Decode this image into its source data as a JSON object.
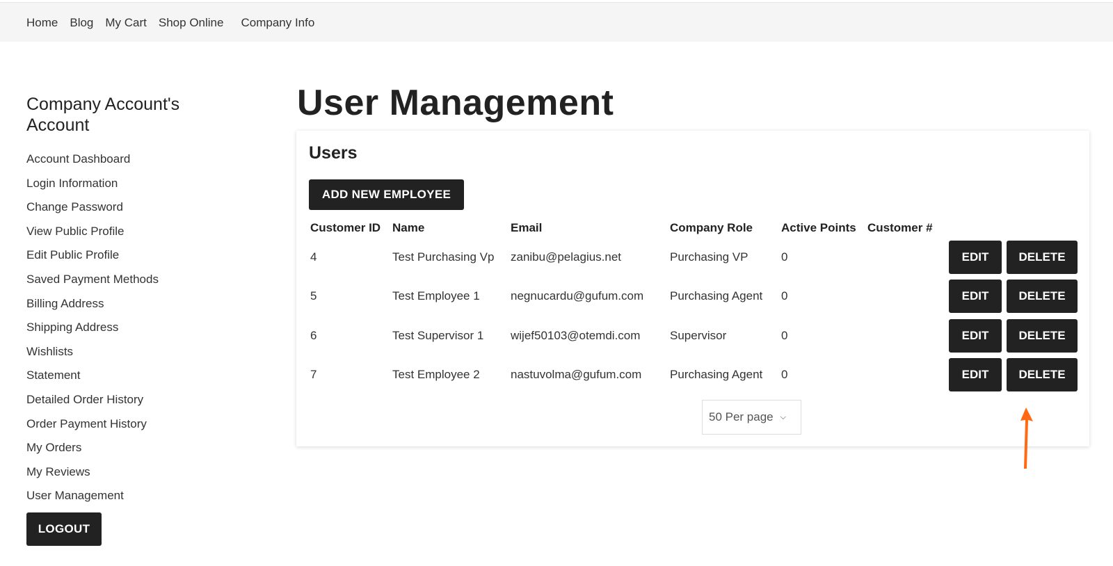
{
  "topnav": {
    "items": [
      "Home",
      "Blog",
      "My Cart",
      "Shop Online",
      "Company Info"
    ]
  },
  "sidebar": {
    "title": "Company Account's Account",
    "items": [
      "Account Dashboard",
      "Login Information",
      "Change Password",
      "View Public Profile",
      "Edit Public Profile",
      "Saved Payment Methods",
      "Billing Address",
      "Shipping Address",
      "Wishlists",
      "Statement",
      "Detailed Order History",
      "Order Payment History",
      "My Orders",
      "My Reviews",
      "User Management"
    ],
    "logout_label": "LOGOUT"
  },
  "page": {
    "title": "User Management"
  },
  "users": {
    "title": "Users",
    "add_label": "ADD NEW EMPLOYEE",
    "columns": [
      "Customer ID",
      "Name",
      "Email",
      "Company Role",
      "Active Points",
      "Customer #"
    ],
    "rows": [
      {
        "id": "4",
        "name": "Test Purchasing Vp",
        "email": "zanibu@pelagius.net",
        "role": "Purchasing VP",
        "points": "0",
        "customer_no": ""
      },
      {
        "id": "5",
        "name": "Test Employee 1",
        "email": "negnucardu@gufum.com",
        "role": "Purchasing Agent",
        "points": "0",
        "customer_no": ""
      },
      {
        "id": "6",
        "name": "Test Supervisor 1",
        "email": "wijef50103@otemdi.com",
        "role": "Supervisor",
        "points": "0",
        "customer_no": ""
      },
      {
        "id": "7",
        "name": "Test Employee 2",
        "email": "nastuvolma@gufum.com",
        "role": "Purchasing Agent",
        "points": "0",
        "customer_no": ""
      }
    ],
    "edit_label": "EDIT",
    "delete_label": "DELETE",
    "per_page": "50 Per page"
  },
  "colors": {
    "button_bg": "#222222",
    "arrow": "#ff6a13",
    "topbar_bg": "#f5f5f5"
  }
}
